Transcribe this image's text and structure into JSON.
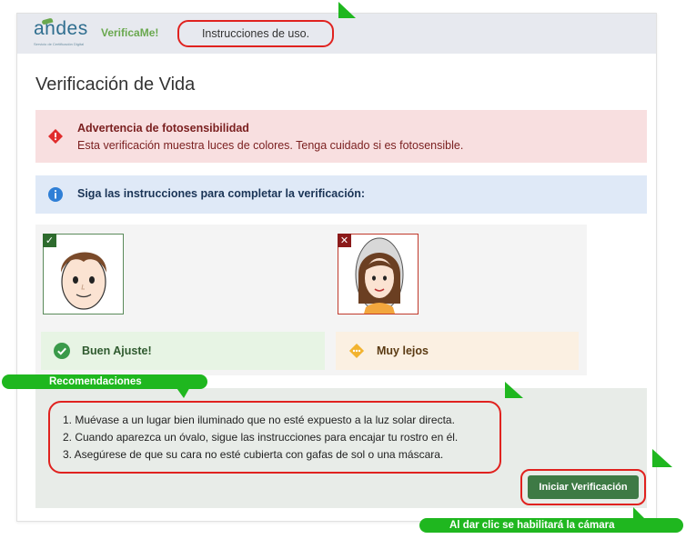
{
  "header": {
    "logo_text": "andes",
    "logo_subtext": "Servicio de Certificación Digital",
    "app_name": "VerificaMe!",
    "nav_link": "Instrucciones de uso."
  },
  "page": {
    "title": "Verificación de Vida"
  },
  "warning": {
    "heading": "Advertencia de fotosensibilidad",
    "text": "Esta verificación muestra luces de colores. Tenga cuidado si es fotosensible."
  },
  "info": {
    "text": "Siga las instrucciones para completar la verificación:"
  },
  "examples": {
    "good": {
      "status": "Buen Ajuste!",
      "tag": "✓"
    },
    "bad": {
      "status": "Muy lejos",
      "tag": "✕"
    }
  },
  "recommendations": {
    "label": "Recomendaciones",
    "items": [
      "1. Muévase a un lugar bien iluminado que no esté expuesto a la luz solar directa.",
      "2. Cuando aparezca un óvalo, sigue las instrucciones para encajar tu rostro en él.",
      "3. Asegúrese de que su cara no esté cubierta con gafas de sol o una máscara."
    ]
  },
  "actions": {
    "start_label": "Iniciar Verificación",
    "camera_note": "Al dar clic se habilitará la cámara"
  },
  "colors": {
    "accent_green": "#3e7a45",
    "annotation_green": "#1fb71f",
    "annotation_red": "#e0221f"
  }
}
